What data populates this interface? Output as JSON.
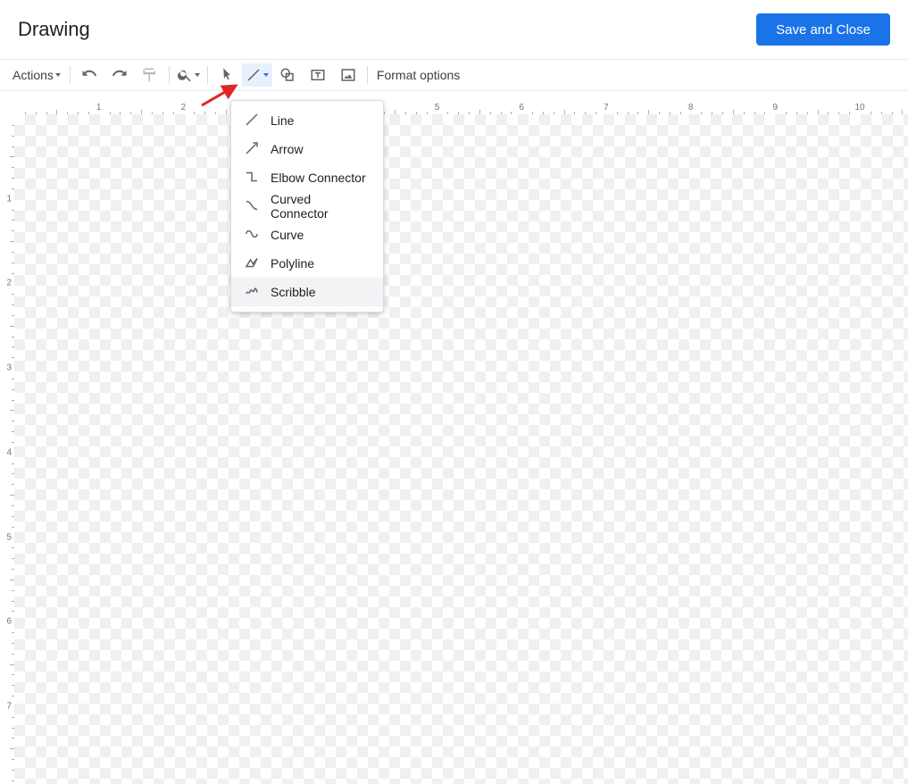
{
  "header": {
    "title": "Drawing",
    "save_close": "Save and Close"
  },
  "toolbar": {
    "actions_label": "Actions",
    "format_options": "Format options"
  },
  "line_menu": {
    "items": [
      {
        "label": "Line",
        "icon": "line"
      },
      {
        "label": "Arrow",
        "icon": "arrow"
      },
      {
        "label": "Elbow Connector",
        "icon": "elbow"
      },
      {
        "label": "Curved Connector",
        "icon": "curved"
      },
      {
        "label": "Curve",
        "icon": "curve"
      },
      {
        "label": "Polyline",
        "icon": "polyline"
      },
      {
        "label": "Scribble",
        "icon": "scribble"
      }
    ],
    "highlighted_index": 6
  }
}
